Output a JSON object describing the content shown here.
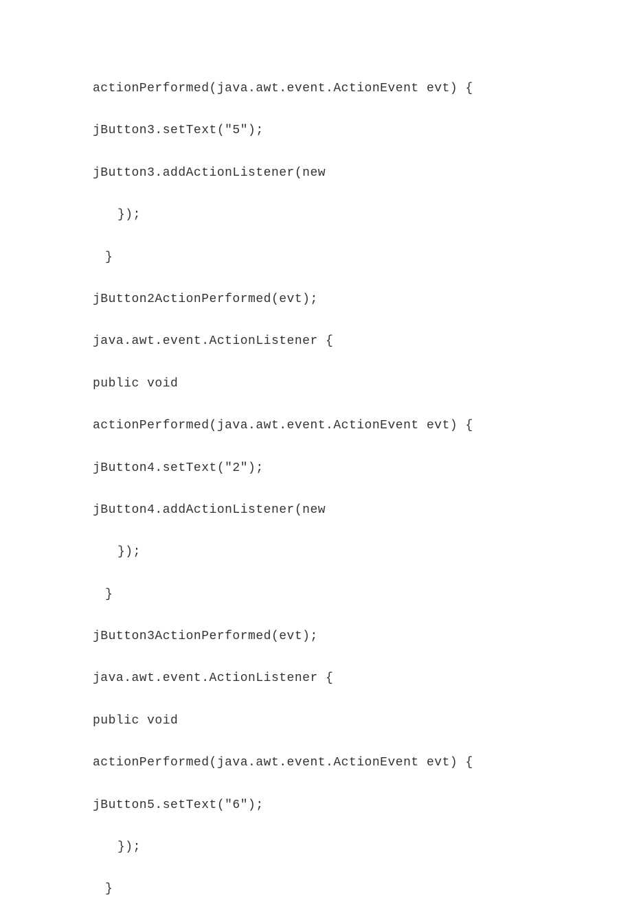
{
  "lines": [
    {
      "text": "actionPerformed(java.awt.event.ActionEvent evt) {",
      "indent": ""
    },
    {
      "text": "jButton3.setText(\"5\");",
      "indent": ""
    },
    {
      "text": "jButton3.addActionListener(new",
      "indent": ""
    },
    {
      "text": "});",
      "indent": "indent1"
    },
    {
      "text": "}",
      "indent": "indent1b"
    },
    {
      "text": "jButton2ActionPerformed(evt);",
      "indent": ""
    },
    {
      "text": "java.awt.event.ActionListener {",
      "indent": ""
    },
    {
      "text": "public void",
      "indent": ""
    },
    {
      "text": "actionPerformed(java.awt.event.ActionEvent evt) {",
      "indent": ""
    },
    {
      "text": "jButton4.setText(\"2\");",
      "indent": ""
    },
    {
      "text": "jButton4.addActionListener(new",
      "indent": ""
    },
    {
      "text": "});",
      "indent": "indent1"
    },
    {
      "text": "}",
      "indent": "indent1b"
    },
    {
      "text": "jButton3ActionPerformed(evt);",
      "indent": ""
    },
    {
      "text": "java.awt.event.ActionListener {",
      "indent": ""
    },
    {
      "text": "public void",
      "indent": ""
    },
    {
      "text": "actionPerformed(java.awt.event.ActionEvent evt) {",
      "indent": ""
    },
    {
      "text": "jButton5.setText(\"6\");",
      "indent": ""
    },
    {
      "text": "});",
      "indent": "indent1"
    },
    {
      "text": "}",
      "indent": "indent1b"
    }
  ]
}
